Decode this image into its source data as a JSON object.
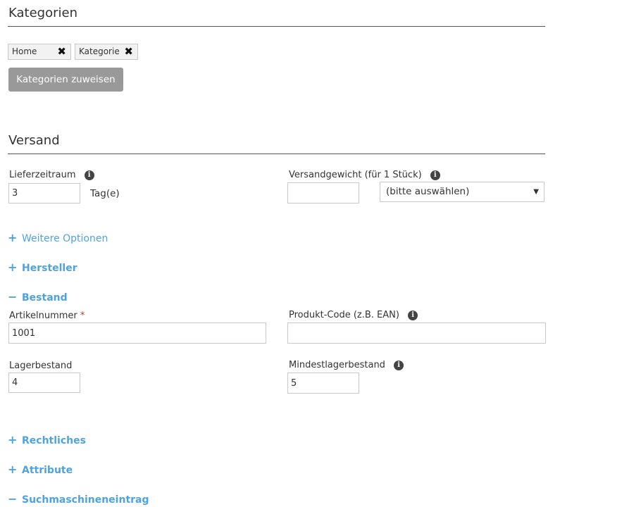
{
  "categories": {
    "title": "Kategorien",
    "tags": [
      {
        "label": "Home"
      },
      {
        "label": "Kategorie"
      }
    ],
    "assign_button": "Kategorien zuweisen"
  },
  "shipping": {
    "title": "Versand",
    "delivery_time_label": "Lieferzeitraum",
    "delivery_time_value": "3",
    "delivery_unit": "Tag(e)",
    "weight_label": "Versandgewicht (für 1 Stück)",
    "weight_value": "",
    "weight_unit_select": "(bitte auswählen)"
  },
  "expanders": {
    "more_options": {
      "symbol": "+",
      "label": "Weitere Optionen"
    },
    "manufacturer": {
      "symbol": "+",
      "label": "Hersteller"
    },
    "stock": {
      "symbol": "−",
      "label": "Bestand"
    },
    "legal": {
      "symbol": "+",
      "label": "Rechtliches"
    },
    "attributes": {
      "symbol": "+",
      "label": "Attribute"
    },
    "seo": {
      "symbol": "−",
      "label": "Suchmaschineneintrag"
    }
  },
  "stock": {
    "article_number_label": "Artikelnummer",
    "required_mark": "*",
    "article_number_value": "1001",
    "product_code_label": "Produkt-Code (z.B. EAN)",
    "product_code_value": "",
    "stock_label": "Lagerbestand",
    "stock_value": "4",
    "min_stock_label": "Mindestlagerbestand",
    "min_stock_value": "5"
  },
  "icons": {
    "info": "i",
    "remove": "✖",
    "caret": "▼"
  }
}
